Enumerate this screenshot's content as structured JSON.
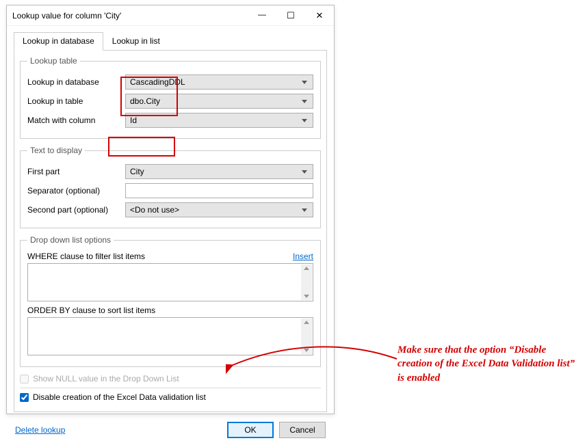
{
  "window": {
    "title": "Lookup value for column 'City'"
  },
  "tabs": {
    "database": "Lookup in database",
    "list": "Lookup in list"
  },
  "lookup_table": {
    "legend": "Lookup table",
    "database_label": "Lookup in database",
    "database_value": "CascadingDDL",
    "table_label": "Lookup in table",
    "table_value": "dbo.City",
    "match_label": "Match with column",
    "match_value": "Id"
  },
  "text_display": {
    "legend": "Text to display",
    "first_label": "First part",
    "first_value": "City",
    "sep_label": "Separator (optional)",
    "sep_value": "",
    "second_label": "Second part (optional)",
    "second_value": "<Do not use>"
  },
  "ddl_options": {
    "legend": "Drop down list options",
    "where_label": "WHERE clause to filter list items",
    "insert_link": "Insert",
    "order_label": "ORDER BY clause to sort list items"
  },
  "checks": {
    "show_null": "Show NULL value in the Drop Down List",
    "disable_excel": "Disable creation of the Excel Data validation list"
  },
  "footer": {
    "delete": "Delete lookup",
    "ok": "OK",
    "cancel": "Cancel"
  },
  "annotation": "Make sure that the option “Disable creation of the Excel Data Validation list” is enabled"
}
